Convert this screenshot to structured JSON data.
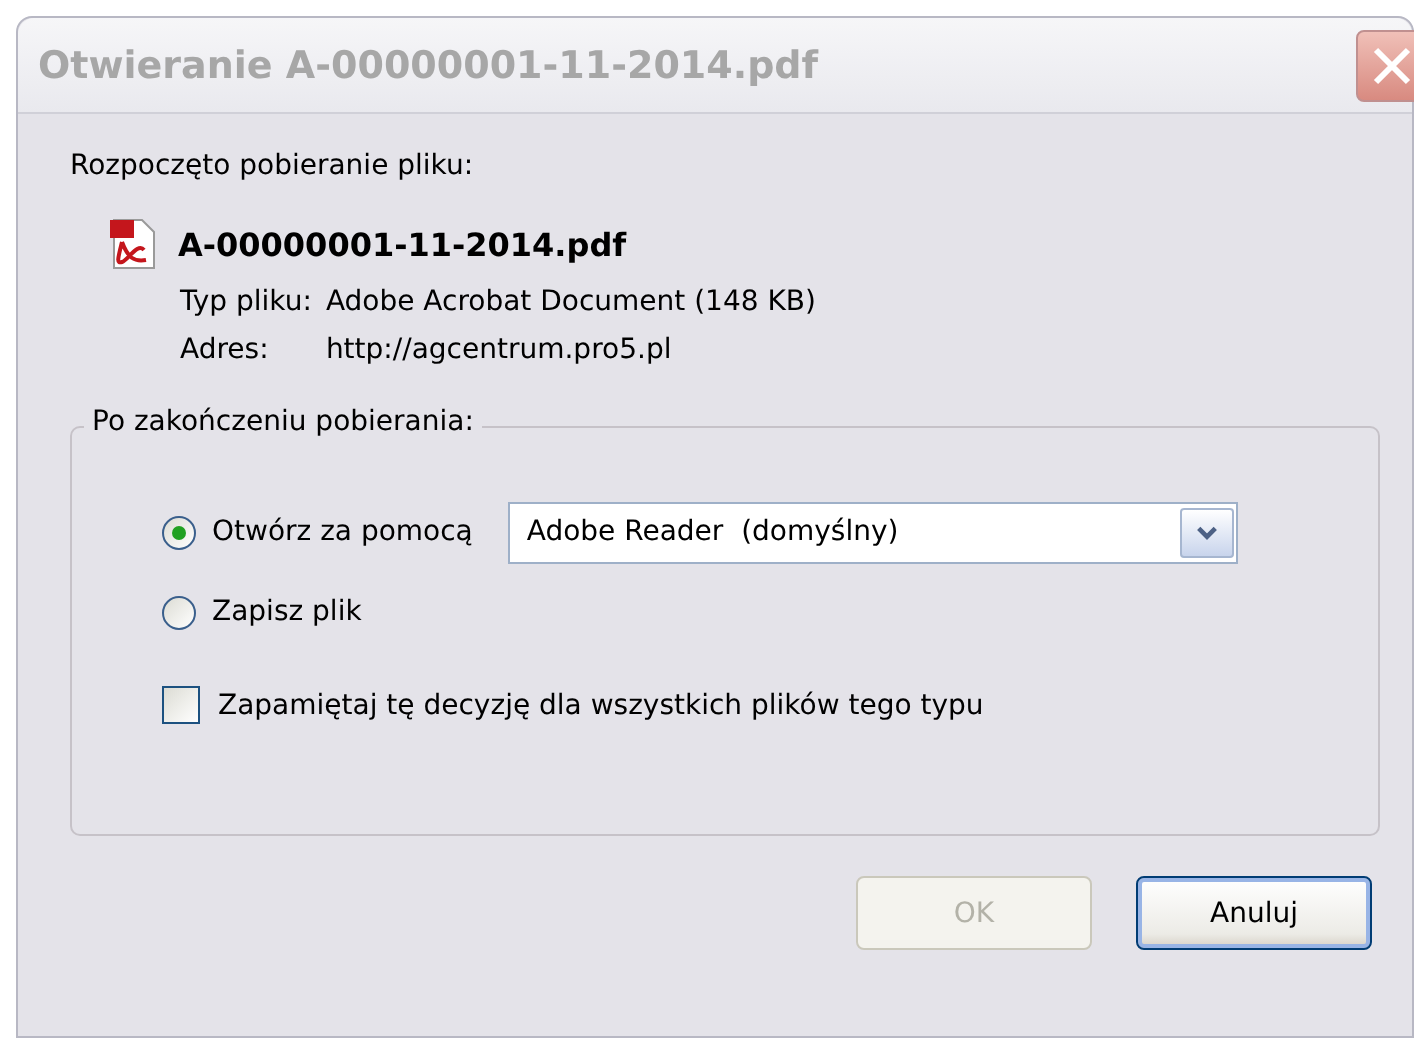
{
  "window": {
    "title": "Otwieranie A-00000001-11-2014.pdf"
  },
  "intro": "Rozpoczęto pobieranie pliku:",
  "file": {
    "name": "A-00000001-11-2014.pdf",
    "type_label": "Typ pliku:",
    "type": "Adobe Acrobat Document (148 KB)",
    "address_label": "Adres:",
    "address": "http://agcentrum.pro5.pl"
  },
  "group": {
    "title": "Po zakończeniu pobierania:",
    "options": [
      {
        "kind": "open_with",
        "label": "Otwórz za pomocą",
        "selected": true,
        "app": "Adobe Reader  (domyślny)"
      },
      {
        "kind": "save",
        "label": "Zapisz plik",
        "selected": false
      }
    ],
    "remember": {
      "label": "Zapamiętaj tę decyzję dla wszystkich plików tego typu",
      "checked": false
    }
  },
  "buttons": [
    {
      "label": "OK",
      "disabled": true,
      "default": false
    },
    {
      "label": "Anuluj",
      "disabled": false,
      "default": true
    }
  ]
}
